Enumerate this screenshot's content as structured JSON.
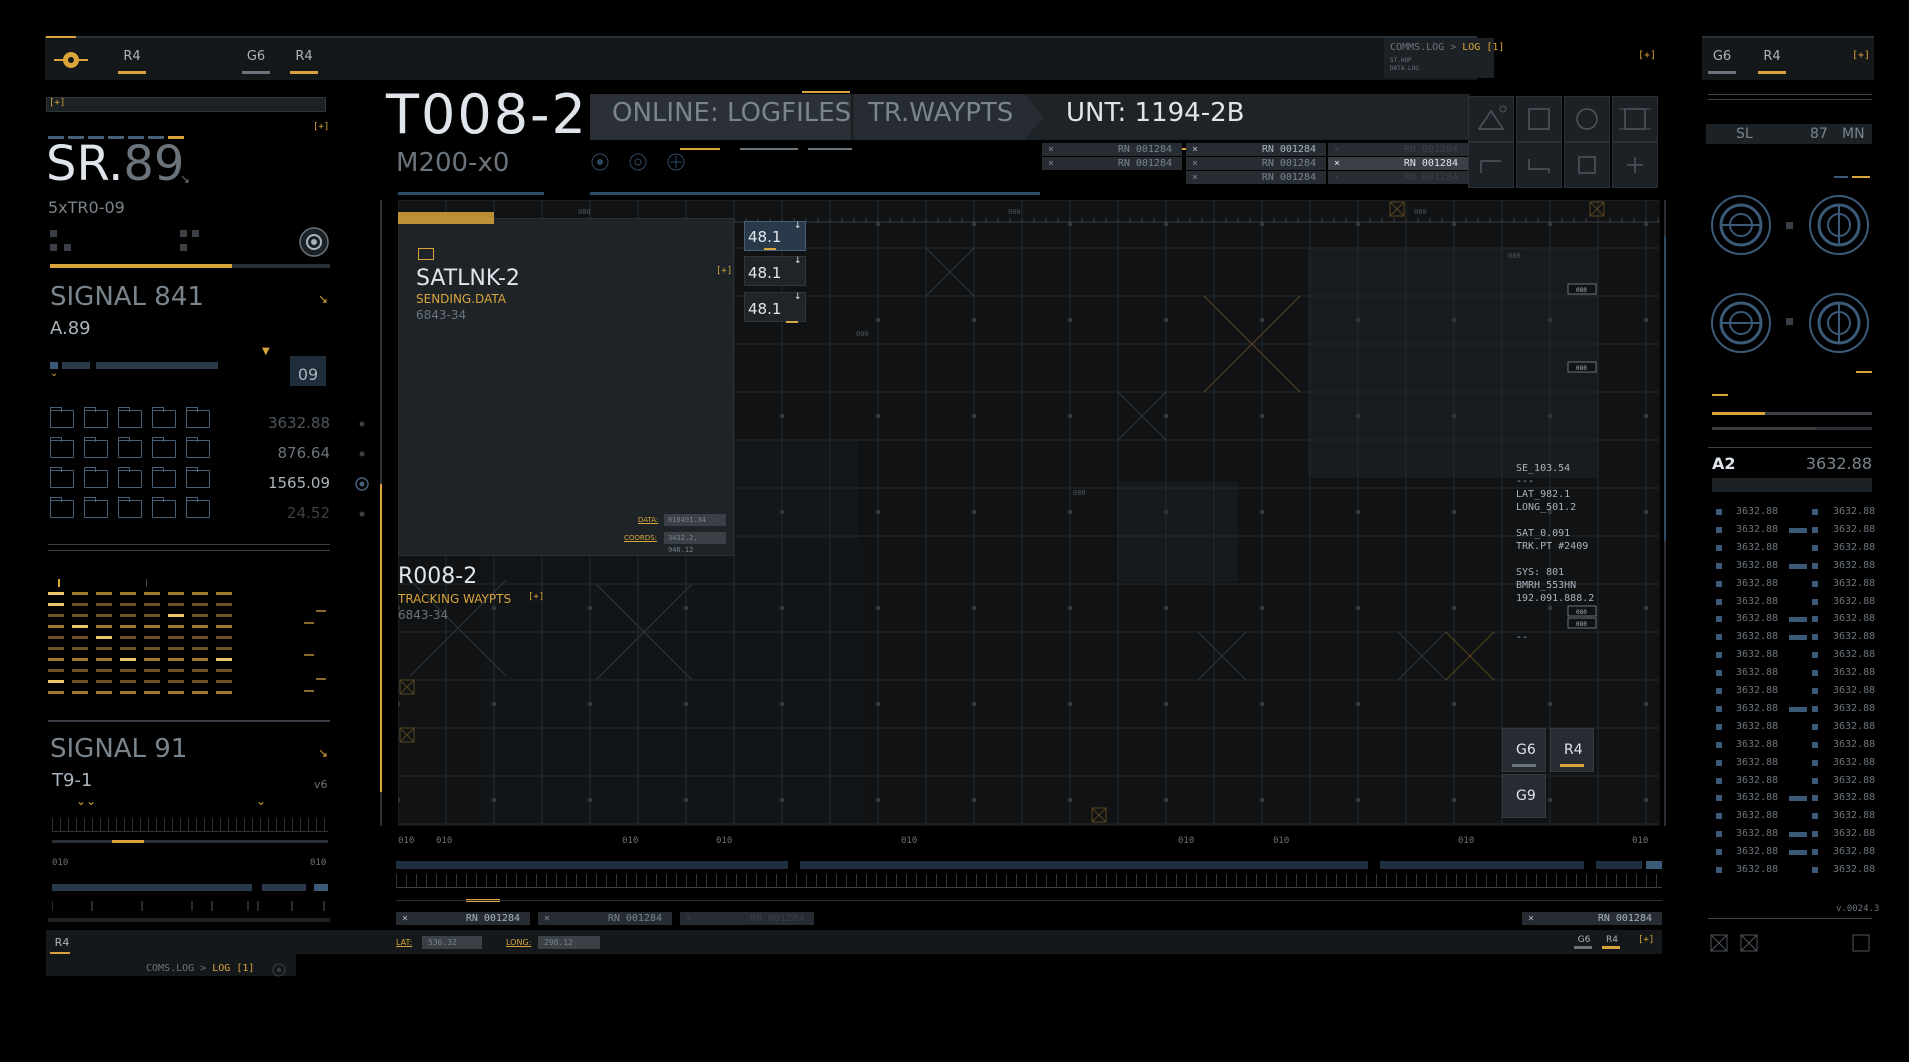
{
  "top_bar": {
    "tabs_left": [
      "R4"
    ],
    "tabs_mid": [
      "G6",
      "R4"
    ],
    "comms": {
      "prefix": "COMMS.LOG > ",
      "suffix": "LOG [1]",
      "sub1": "ST.HOP",
      "sub2": "DATA.LOG"
    },
    "bracket": "[+]"
  },
  "right_tabs": [
    "G6",
    "R4"
  ],
  "left_panel": {
    "bracket": "[+]",
    "sr_main": "SR.",
    "sr_dim": "89",
    "sr_sub": "5xTR0-09",
    "signal1_title": "SIGNAL 841",
    "signal1_sub": "A.89",
    "badge": "09",
    "values": [
      "3632.88",
      "876.64",
      "1565.09",
      "24.52"
    ],
    "signal2_title": "SIGNAL 91",
    "signal2_sub": "T9-1",
    "signal2_ver": "v6",
    "scale_left": "010",
    "scale_right": "010",
    "footer_tab": "R4",
    "footer_comms_prefix": "COMS.LOG > ",
    "footer_comms_suffix": "LOG [1]"
  },
  "header": {
    "title": "T008-2",
    "subtitle": "M200-x0",
    "tab1": "ONLINE: LOGFILES",
    "tab2": "TR.WAYPTS",
    "unit": "UNT: 1194-2B",
    "rn_label": "RN 001284"
  },
  "satlink": {
    "title": "SATLNK-2",
    "status": "SENDING.DATA",
    "code": "6843-34",
    "bracket": "[+]",
    "data_label": "DATA:",
    "data_value": "818491.34",
    "coords_label": "COORDS:",
    "coords_value": "3432.2, 946.12"
  },
  "readouts": [
    "48.1",
    "48.1",
    "48.1"
  ],
  "r008": {
    "title": "R008-2",
    "status": "TRACKING WAYPTS",
    "code": "6843-34",
    "bracket": "[+]"
  },
  "map": {
    "tick": "080",
    "info_block": [
      "SE_103.54",
      "---",
      "LAT_982.1",
      "LONG_501.2",
      "",
      "SAT_0.091",
      "TRK.PT #2409",
      "",
      "SYS: 801",
      "BMRH_553HN",
      "192.091.888.2",
      "",
      "",
      "--"
    ],
    "buttons": [
      "G6",
      "R4",
      "G9"
    ],
    "scale": [
      "010",
      "010",
      "010",
      "010",
      "010",
      "010",
      "010",
      "010",
      "010"
    ]
  },
  "bottom": {
    "lat_label": "LAT:",
    "lat_value": "536.32",
    "long_label": "LONG:",
    "long_value": "298.12",
    "tabs": [
      "G6",
      "R4"
    ],
    "bracket": "[+]"
  },
  "right_panel": {
    "sl": "SL",
    "sl_value": "87",
    "sl_unit": "MN",
    "a2_label": "A2",
    "a2_value": "3632.88",
    "row_value": "3632.88",
    "version": "v.0024.3"
  },
  "colors": {
    "accent": "#d9a53a",
    "panel": "#15191d",
    "blue": "#3a5a78"
  }
}
